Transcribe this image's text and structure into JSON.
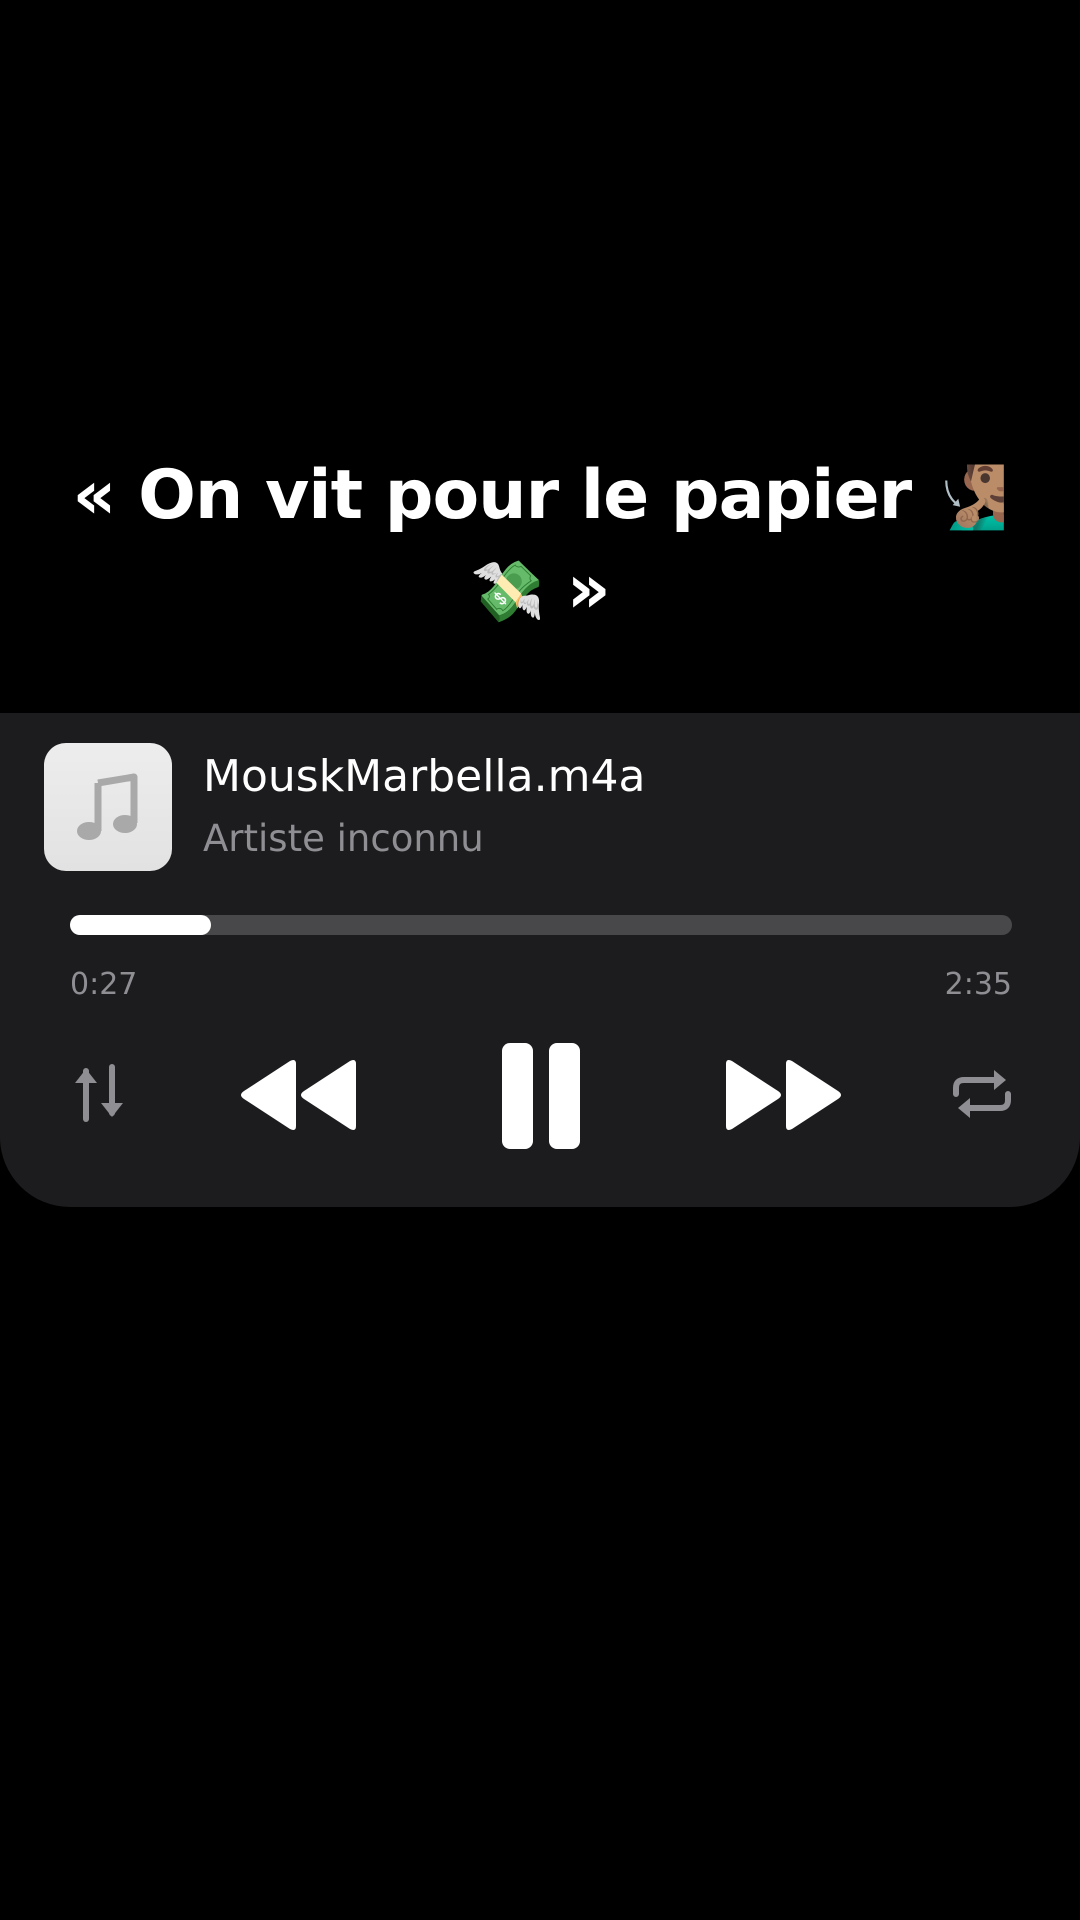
{
  "caption": {
    "text": "« On vit pour le papier",
    "emoji_1": "🧏🏽‍♂️",
    "emoji_2": "💸",
    "closing": "»"
  },
  "player": {
    "artwork_icon": "music-note-icon",
    "title": "MouskMarbella.m4a",
    "artist": "Artiste inconnu",
    "elapsed": "0:27",
    "duration": "2:35",
    "progress_fraction": 0.15,
    "controls": [
      {
        "name": "shuffle-order",
        "icon": "up-down-arrows-icon"
      },
      {
        "name": "rewind",
        "icon": "rewind-icon"
      },
      {
        "name": "pause",
        "icon": "pause-icon"
      },
      {
        "name": "fast-forward",
        "icon": "fast-forward-icon"
      },
      {
        "name": "repeat",
        "icon": "repeat-icon"
      }
    ]
  },
  "colors": {
    "background": "#000000",
    "panel": "#1c1c1e",
    "text_primary": "#ffffff",
    "text_secondary": "#8e8e93",
    "progress_track": "#48484a"
  }
}
